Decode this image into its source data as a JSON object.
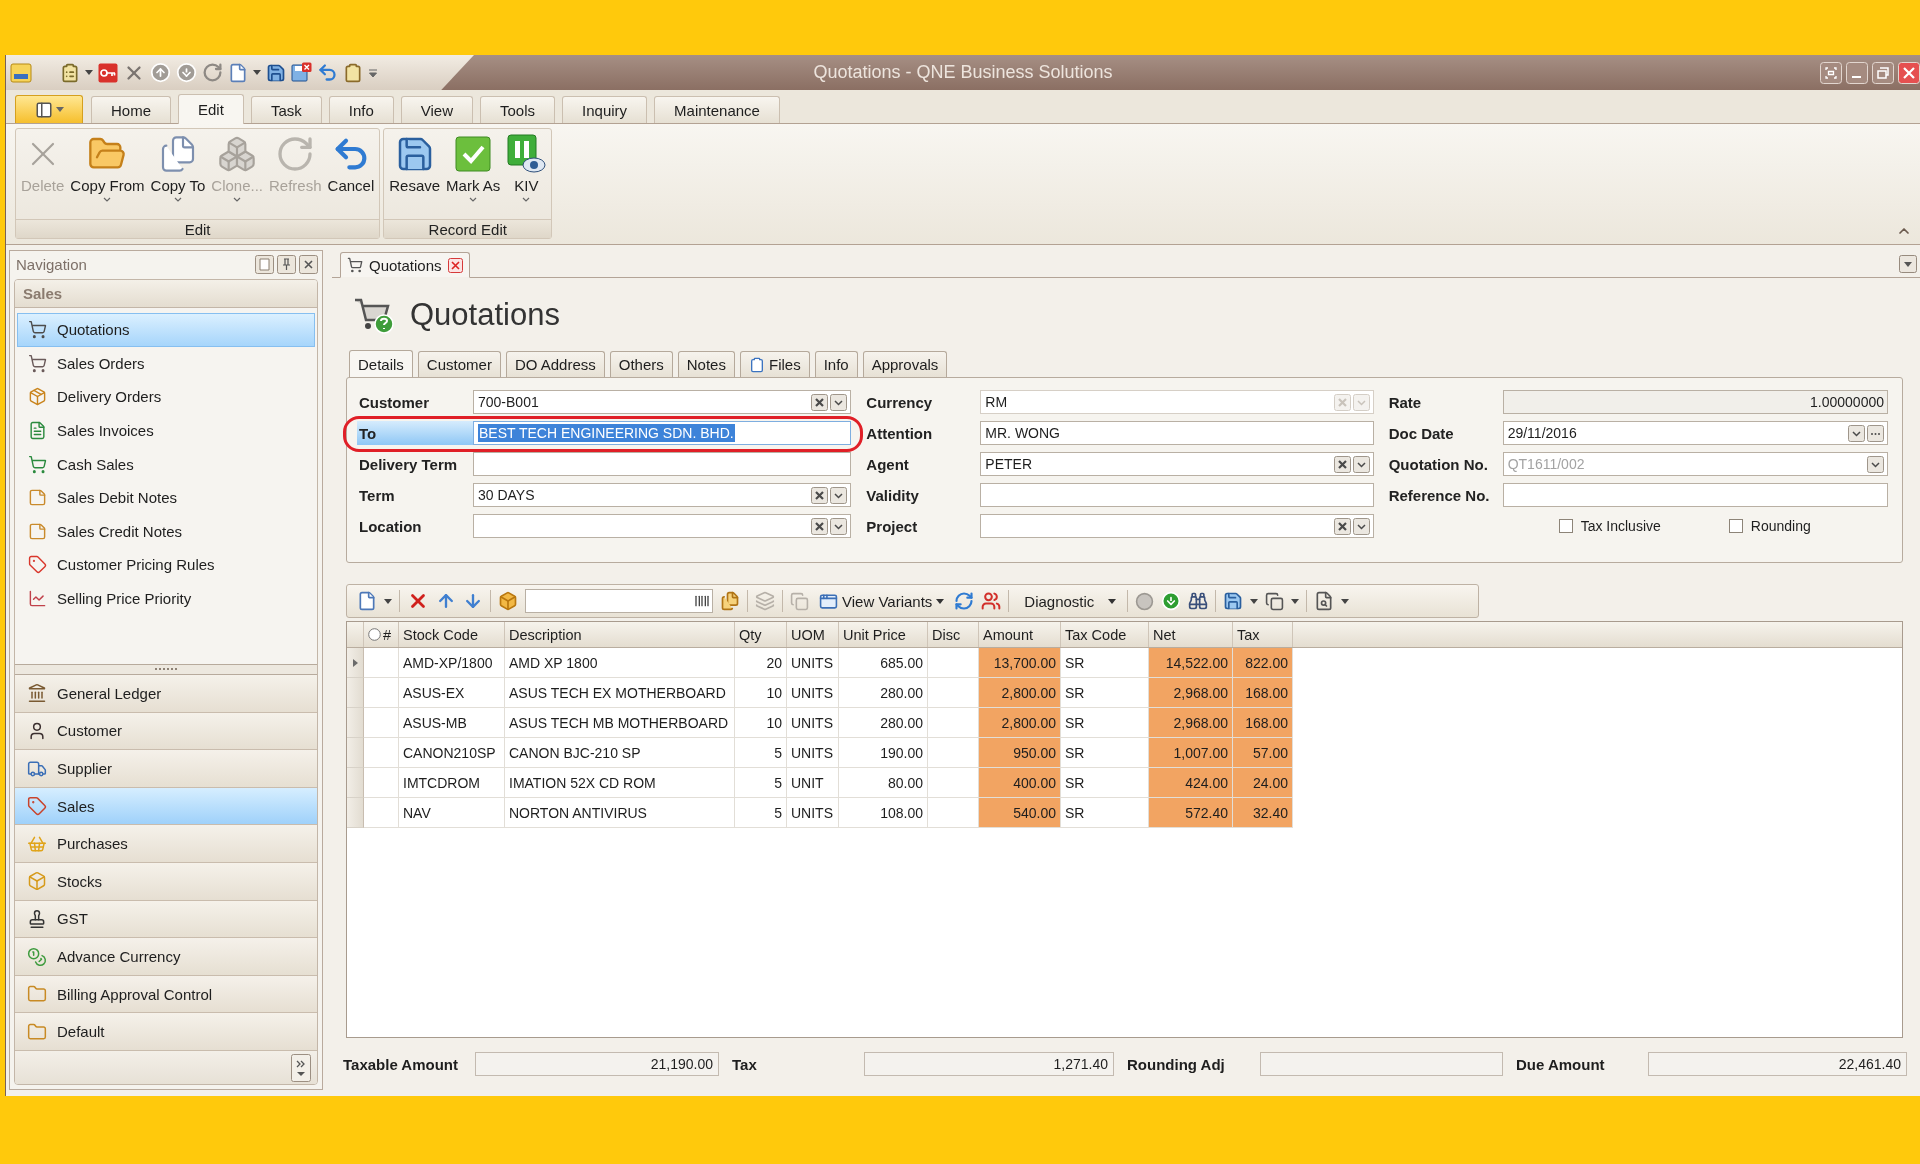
{
  "window": {
    "title": "Quotations - QNE Business Solutions"
  },
  "ribbon": {
    "tabs": [
      {
        "label": "Home",
        "selected": false
      },
      {
        "label": "Edit",
        "selected": true
      },
      {
        "label": "Task",
        "selected": false
      },
      {
        "label": "Info",
        "selected": false
      },
      {
        "label": "View",
        "selected": false
      },
      {
        "label": "Tools",
        "selected": false
      },
      {
        "label": "Inquiry",
        "selected": false
      },
      {
        "label": "Maintenance",
        "selected": false
      }
    ],
    "groups": [
      {
        "title": "Edit",
        "buttons": [
          {
            "label": "Delete",
            "disabled": true,
            "dropdown": false
          },
          {
            "label": "Copy From",
            "disabled": false,
            "dropdown": true
          },
          {
            "label": "Copy To",
            "disabled": false,
            "dropdown": true
          },
          {
            "label": "Clone...",
            "disabled": true,
            "dropdown": true
          },
          {
            "label": "Refresh",
            "disabled": true,
            "dropdown": false
          },
          {
            "label": "Cancel",
            "disabled": false,
            "dropdown": false
          }
        ]
      },
      {
        "title": "Record Edit",
        "buttons": [
          {
            "label": "Resave",
            "disabled": false,
            "dropdown": false
          },
          {
            "label": "Mark As",
            "disabled": false,
            "dropdown": true
          },
          {
            "label": "KIV",
            "disabled": false,
            "dropdown": true
          }
        ]
      }
    ]
  },
  "navigation": {
    "title": "Navigation",
    "group": "Sales",
    "items": [
      {
        "label": "Quotations",
        "selected": true
      },
      {
        "label": "Sales Orders",
        "selected": false
      },
      {
        "label": "Delivery Orders",
        "selected": false
      },
      {
        "label": "Sales Invoices",
        "selected": false
      },
      {
        "label": "Cash Sales",
        "selected": false
      },
      {
        "label": "Sales Debit Notes",
        "selected": false
      },
      {
        "label": "Sales Credit Notes",
        "selected": false
      },
      {
        "label": "Customer Pricing Rules",
        "selected": false
      },
      {
        "label": "Selling Price Priority",
        "selected": false
      }
    ],
    "modules": [
      {
        "label": "General Ledger",
        "selected": false
      },
      {
        "label": "Customer",
        "selected": false
      },
      {
        "label": "Supplier",
        "selected": false
      },
      {
        "label": "Sales",
        "selected": true
      },
      {
        "label": "Purchases",
        "selected": false
      },
      {
        "label": "Stocks",
        "selected": false
      },
      {
        "label": "GST",
        "selected": false
      },
      {
        "label": "Advance Currency",
        "selected": false
      },
      {
        "label": "Billing Approval Control",
        "selected": false
      },
      {
        "label": "Default",
        "selected": false
      }
    ]
  },
  "document": {
    "tab": "Quotations",
    "heading": "Quotations",
    "tabs": [
      {
        "label": "Details",
        "selected": true
      },
      {
        "label": "Customer",
        "selected": false
      },
      {
        "label": "DO Address",
        "selected": false
      },
      {
        "label": "Others",
        "selected": false
      },
      {
        "label": "Notes",
        "selected": false
      },
      {
        "label": "Files",
        "selected": false
      },
      {
        "label": "Info",
        "selected": false
      },
      {
        "label": "Approvals",
        "selected": false
      }
    ],
    "form": {
      "columns": [
        {
          "fields": [
            {
              "label": "Customer",
              "value": "700-B001",
              "kind": "lookup",
              "disabled": false,
              "focused": false,
              "callout": false
            },
            {
              "label": "To",
              "value": "BEST TECH ENGINEERING SDN. BHD.",
              "kind": "text",
              "disabled": false,
              "focused": true,
              "callout": true
            },
            {
              "label": "Delivery Term",
              "kind": "text",
              "disabled": false,
              "focused": false,
              "callout": false
            },
            {
              "label": "Term",
              "value": "30 DAYS",
              "kind": "lookup",
              "disabled": false,
              "focused": false,
              "callout": false
            },
            {
              "label": "Location",
              "kind": "lookup",
              "disabled": false,
              "focused": false,
              "callout": false
            }
          ]
        },
        {
          "fields": [
            {
              "label": "Currency",
              "value": "RM",
              "kind": "lookup",
              "disabled": true,
              "focused": false,
              "callout": false
            },
            {
              "label": "Attention",
              "value": "MR. WONG",
              "kind": "text",
              "disabled": false,
              "focused": false,
              "callout": false
            },
            {
              "label": "Agent",
              "value": "PETER",
              "kind": "lookup",
              "disabled": false,
              "focused": false,
              "callout": false
            },
            {
              "label": "Validity",
              "kind": "text",
              "disabled": false,
              "focused": false,
              "callout": false
            },
            {
              "label": "Project",
              "kind": "lookup",
              "disabled": false,
              "focused": false,
              "callout": false
            }
          ]
        },
        {
          "fields": [
            {
              "label": "Rate",
              "value": "1.00000000",
              "kind": "number",
              "disabled": false,
              "focused": false,
              "callout": false
            },
            {
              "label": "Doc Date",
              "value": "29/11/2016",
              "kind": "date",
              "disabled": false,
              "focused": false,
              "callout": false
            },
            {
              "label": "Quotation No.",
              "placeholder": "QT1611/002",
              "kind": "select",
              "disabled": false,
              "focused": false,
              "callout": false
            },
            {
              "label": "Reference No.",
              "kind": "text",
              "disabled": false,
              "focused": false,
              "callout": false
            }
          ]
        }
      ],
      "checkboxes": [
        {
          "label": "Tax Inclusive",
          "checked": false
        },
        {
          "label": "Rounding",
          "checked": false
        }
      ]
    },
    "grid_toolbar": {
      "view_variants": "View Variants",
      "diagnostic": "Diagnostic"
    },
    "table": {
      "columns": [
        {
          "label": "#",
          "kind": "marker",
          "highlight": false
        },
        {
          "label": "Stock Code",
          "kind": "text",
          "highlight": false
        },
        {
          "label": "Description",
          "kind": "text",
          "highlight": false
        },
        {
          "label": "Qty",
          "kind": "number",
          "highlight": false
        },
        {
          "label": "UOM",
          "kind": "text",
          "highlight": false
        },
        {
          "label": "Unit Price",
          "kind": "number",
          "highlight": false
        },
        {
          "label": "Disc",
          "kind": "number",
          "highlight": false
        },
        {
          "label": "Amount",
          "kind": "number",
          "highlight": true
        },
        {
          "label": "Tax Code",
          "kind": "text",
          "highlight": false
        },
        {
          "label": "Net",
          "kind": "number",
          "highlight": true
        },
        {
          "label": "Tax",
          "kind": "number",
          "highlight": true
        }
      ],
      "rows": [
        {
          "current": true,
          "cells": [
            null,
            "AMD-XP/1800",
            "AMD XP 1800",
            "20",
            "UNITS",
            "685.00",
            null,
            "13,700.00",
            "SR",
            "14,522.00",
            "822.00"
          ]
        },
        {
          "current": false,
          "cells": [
            null,
            "ASUS-EX",
            "ASUS TECH EX MOTHERBOARD",
            "10",
            "UNITS",
            "280.00",
            null,
            "2,800.00",
            "SR",
            "2,968.00",
            "168.00"
          ]
        },
        {
          "current": false,
          "cells": [
            null,
            "ASUS-MB",
            "ASUS TECH MB MOTHERBOARD",
            "10",
            "UNITS",
            "280.00",
            null,
            "2,800.00",
            "SR",
            "2,968.00",
            "168.00"
          ]
        },
        {
          "current": false,
          "cells": [
            null,
            "CANON210SP",
            "CANON BJC-210 SP",
            "5",
            "UNITS",
            "190.00",
            null,
            "950.00",
            "SR",
            "1,007.00",
            "57.00"
          ]
        },
        {
          "current": false,
          "cells": [
            null,
            "IMTCDROM",
            "IMATION 52X CD ROM",
            "5",
            "UNIT",
            "80.00",
            null,
            "400.00",
            "SR",
            "424.00",
            "24.00"
          ]
        },
        {
          "current": false,
          "cells": [
            null,
            "NAV",
            "NORTON ANTIVIRUS",
            "5",
            "UNITS",
            "108.00",
            null,
            "540.00",
            "SR",
            "572.40",
            "32.40"
          ]
        }
      ]
    },
    "totals": [
      {
        "label": "Taxable Amount",
        "value": "21,190.00"
      },
      {
        "label": "Tax",
        "value": "1,271.40"
      },
      {
        "label": "Rounding Adj"
      },
      {
        "label": "Due Amount",
        "value": "22,461.40"
      }
    ]
  }
}
